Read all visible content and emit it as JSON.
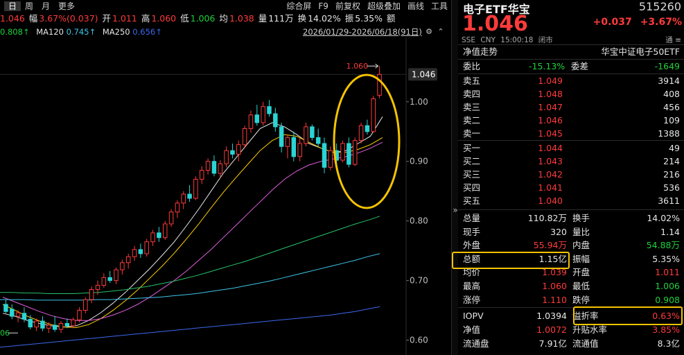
{
  "toolbar": {
    "periods": [
      "日",
      "周",
      "月",
      "更多"
    ],
    "tools": [
      "综合屏",
      "F9",
      "前复权",
      "超级叠加",
      "画线",
      "工具"
    ]
  },
  "quote_line": {
    "price": "1.046",
    "range_label": "幅",
    "range_value": "3.67%(0.037)",
    "open_label": "开",
    "open_value": "1.011",
    "high_label": "高",
    "high_value": "1.060",
    "low_label": "低",
    "low_value": "1.006",
    "avg_label": "均",
    "avg_value": "1.038",
    "vol_label": "量",
    "vol_value": "111万",
    "turn_label": "换",
    "turn_value": "14.02%",
    "amp_label": "振",
    "amp_value": "5.35%",
    "amt_label": "额"
  },
  "ma_line": {
    "ma60_value": "0.808",
    "ma120_label": "MA120",
    "ma120_value": "0.745",
    "ma250_label": "MA250",
    "ma250_value": "0.656"
  },
  "date_range": "2026/01/29-2026/06/18(91日)",
  "chart_data": {
    "type": "candlestick",
    "y_ticks": [
      "1.00",
      "0.90",
      "0.80",
      "0.70",
      "0.60"
    ],
    "ylim": [
      0.575,
      1.108
    ],
    "current_price_tag": "1.046",
    "high_annotation": "1.060",
    "low_annotation_partial": "06",
    "candles": [
      {
        "o": 0.66,
        "h": 0.668,
        "l": 0.645,
        "c": 0.648
      },
      {
        "o": 0.652,
        "h": 0.66,
        "l": 0.635,
        "c": 0.64
      },
      {
        "o": 0.64,
        "h": 0.65,
        "l": 0.63,
        "c": 0.646
      },
      {
        "o": 0.645,
        "h": 0.655,
        "l": 0.63,
        "c": 0.635
      },
      {
        "o": 0.635,
        "h": 0.642,
        "l": 0.618,
        "c": 0.622
      },
      {
        "o": 0.622,
        "h": 0.636,
        "l": 0.615,
        "c": 0.632
      },
      {
        "o": 0.632,
        "h": 0.64,
        "l": 0.615,
        "c": 0.62
      },
      {
        "o": 0.62,
        "h": 0.63,
        "l": 0.612,
        "c": 0.625
      },
      {
        "o": 0.625,
        "h": 0.64,
        "l": 0.614,
        "c": 0.618
      },
      {
        "o": 0.618,
        "h": 0.632,
        "l": 0.612,
        "c": 0.628
      },
      {
        "o": 0.628,
        "h": 0.636,
        "l": 0.62,
        "c": 0.624
      },
      {
        "o": 0.624,
        "h": 0.638,
        "l": 0.62,
        "c": 0.634
      },
      {
        "o": 0.634,
        "h": 0.655,
        "l": 0.63,
        "c": 0.65
      },
      {
        "o": 0.65,
        "h": 0.672,
        "l": 0.645,
        "c": 0.668
      },
      {
        "o": 0.668,
        "h": 0.69,
        "l": 0.662,
        "c": 0.685
      },
      {
        "o": 0.685,
        "h": 0.7,
        "l": 0.676,
        "c": 0.692
      },
      {
        "o": 0.692,
        "h": 0.712,
        "l": 0.688,
        "c": 0.705
      },
      {
        "o": 0.705,
        "h": 0.716,
        "l": 0.696,
        "c": 0.7
      },
      {
        "o": 0.7,
        "h": 0.722,
        "l": 0.694,
        "c": 0.718
      },
      {
        "o": 0.718,
        "h": 0.735,
        "l": 0.71,
        "c": 0.73
      },
      {
        "o": 0.73,
        "h": 0.745,
        "l": 0.72,
        "c": 0.74
      },
      {
        "o": 0.74,
        "h": 0.758,
        "l": 0.733,
        "c": 0.752
      },
      {
        "o": 0.752,
        "h": 0.762,
        "l": 0.738,
        "c": 0.745
      },
      {
        "o": 0.745,
        "h": 0.77,
        "l": 0.74,
        "c": 0.765
      },
      {
        "o": 0.765,
        "h": 0.785,
        "l": 0.758,
        "c": 0.78
      },
      {
        "o": 0.78,
        "h": 0.79,
        "l": 0.765,
        "c": 0.772
      },
      {
        "o": 0.772,
        "h": 0.8,
        "l": 0.768,
        "c": 0.795
      },
      {
        "o": 0.795,
        "h": 0.82,
        "l": 0.79,
        "c": 0.815
      },
      {
        "o": 0.815,
        "h": 0.835,
        "l": 0.805,
        "c": 0.83
      },
      {
        "o": 0.83,
        "h": 0.85,
        "l": 0.82,
        "c": 0.845
      },
      {
        "o": 0.845,
        "h": 0.86,
        "l": 0.832,
        "c": 0.838
      },
      {
        "o": 0.838,
        "h": 0.875,
        "l": 0.835,
        "c": 0.87
      },
      {
        "o": 0.87,
        "h": 0.892,
        "l": 0.862,
        "c": 0.885
      },
      {
        "o": 0.885,
        "h": 0.905,
        "l": 0.878,
        "c": 0.9
      },
      {
        "o": 0.9,
        "h": 0.91,
        "l": 0.875,
        "c": 0.88
      },
      {
        "o": 0.88,
        "h": 0.902,
        "l": 0.872,
        "c": 0.896
      },
      {
        "o": 0.896,
        "h": 0.925,
        "l": 0.89,
        "c": 0.918
      },
      {
        "o": 0.918,
        "h": 0.93,
        "l": 0.905,
        "c": 0.912
      },
      {
        "o": 0.912,
        "h": 0.935,
        "l": 0.9,
        "c": 0.928
      },
      {
        "o": 0.928,
        "h": 0.96,
        "l": 0.922,
        "c": 0.955
      },
      {
        "o": 0.955,
        "h": 0.985,
        "l": 0.948,
        "c": 0.978
      },
      {
        "o": 0.978,
        "h": 0.995,
        "l": 0.96,
        "c": 0.965
      },
      {
        "o": 0.965,
        "h": 1.0,
        "l": 0.96,
        "c": 0.992
      },
      {
        "o": 0.992,
        "h": 1.003,
        "l": 0.975,
        "c": 0.98
      },
      {
        "o": 0.98,
        "h": 0.99,
        "l": 0.95,
        "c": 0.958
      },
      {
        "o": 0.958,
        "h": 0.965,
        "l": 0.915,
        "c": 0.925
      },
      {
        "o": 0.925,
        "h": 0.945,
        "l": 0.905,
        "c": 0.94
      },
      {
        "o": 0.94,
        "h": 0.95,
        "l": 0.9,
        "c": 0.908
      },
      {
        "o": 0.908,
        "h": 0.94,
        "l": 0.9,
        "c": 0.93
      },
      {
        "o": 0.93,
        "h": 0.965,
        "l": 0.925,
        "c": 0.958
      },
      {
        "o": 0.958,
        "h": 0.962,
        "l": 0.935,
        "c": 0.94
      },
      {
        "o": 0.94,
        "h": 0.955,
        "l": 0.925,
        "c": 0.93
      },
      {
        "o": 0.93,
        "h": 0.94,
        "l": 0.88,
        "c": 0.89
      },
      {
        "o": 0.89,
        "h": 0.925,
        "l": 0.885,
        "c": 0.918
      },
      {
        "o": 0.918,
        "h": 0.93,
        "l": 0.895,
        "c": 0.902
      },
      {
        "o": 0.902,
        "h": 0.935,
        "l": 0.898,
        "c": 0.93
      },
      {
        "o": 0.93,
        "h": 0.94,
        "l": 0.89,
        "c": 0.895
      },
      {
        "o": 0.895,
        "h": 0.94,
        "l": 0.892,
        "c": 0.935
      },
      {
        "o": 0.935,
        "h": 0.965,
        "l": 0.93,
        "c": 0.96
      },
      {
        "o": 0.96,
        "h": 0.97,
        "l": 0.945,
        "c": 0.95
      },
      {
        "o": 0.95,
        "h": 1.01,
        "l": 0.948,
        "c": 1.005
      },
      {
        "o": 1.011,
        "h": 1.06,
        "l": 1.006,
        "c": 1.046
      }
    ],
    "ma_series": [
      {
        "name": "short",
        "color": "#e8e8e8",
        "values": [
          0.645,
          0.64,
          0.633,
          0.628,
          0.624,
          0.622,
          0.624,
          0.633,
          0.646,
          0.662,
          0.68,
          0.7,
          0.72,
          0.742,
          0.765,
          0.792,
          0.82,
          0.85,
          0.88,
          0.905,
          0.93,
          0.955,
          0.965,
          0.958,
          0.945,
          0.93,
          0.922,
          0.915,
          0.918,
          0.93,
          0.942,
          0.975
        ]
      },
      {
        "name": "mid",
        "color": "#ffd000",
        "values": [
          0.66,
          0.65,
          0.64,
          0.632,
          0.626,
          0.622,
          0.621,
          0.626,
          0.636,
          0.65,
          0.666,
          0.684,
          0.704,
          0.724,
          0.746,
          0.77,
          0.795,
          0.822,
          0.848,
          0.872,
          0.895,
          0.918,
          0.935,
          0.945,
          0.942,
          0.932,
          0.922,
          0.915,
          0.915,
          0.92,
          0.928,
          0.94
        ]
      },
      {
        "name": "long",
        "color": "#e060e0",
        "values": [
          0.672,
          0.664,
          0.656,
          0.648,
          0.641,
          0.636,
          0.633,
          0.633,
          0.636,
          0.642,
          0.65,
          0.66,
          0.672,
          0.686,
          0.7,
          0.716,
          0.734,
          0.752,
          0.772,
          0.792,
          0.812,
          0.832,
          0.852,
          0.87,
          0.884,
          0.894,
          0.9,
          0.904,
          0.908,
          0.914,
          0.922,
          0.932
        ]
      },
      {
        "name": "MA60",
        "color": "#26c26a",
        "values": [
          0.68,
          0.68,
          0.679,
          0.679,
          0.678,
          0.678,
          0.678,
          0.679,
          0.68,
          0.682,
          0.684,
          0.687,
          0.69,
          0.694,
          0.698,
          0.703,
          0.708,
          0.714,
          0.72,
          0.726,
          0.732,
          0.739,
          0.746,
          0.753,
          0.76,
          0.767,
          0.774,
          0.781,
          0.788,
          0.795,
          0.801,
          0.808
        ]
      },
      {
        "name": "MA120",
        "color": "#3ec6ea",
        "values": [
          0.668,
          0.668,
          0.668,
          0.667,
          0.667,
          0.667,
          0.667,
          0.667,
          0.668,
          0.668,
          0.669,
          0.67,
          0.671,
          0.672,
          0.674,
          0.676,
          0.678,
          0.681,
          0.684,
          0.687,
          0.691,
          0.695,
          0.699,
          0.704,
          0.709,
          0.714,
          0.719,
          0.724,
          0.729,
          0.734,
          0.74,
          0.745
        ]
      },
      {
        "name": "MA250",
        "color": "#3b68f0",
        "values": [
          0.588,
          0.59,
          0.592,
          0.594,
          0.596,
          0.598,
          0.6,
          0.602,
          0.604,
          0.606,
          0.608,
          0.61,
          0.612,
          0.614,
          0.616,
          0.618,
          0.62,
          0.622,
          0.624,
          0.626,
          0.628,
          0.63,
          0.632,
          0.634,
          0.636,
          0.638,
          0.64,
          0.642,
          0.645,
          0.648,
          0.652,
          0.656
        ]
      }
    ]
  },
  "panel": {
    "name": "电子ETF华宝",
    "code": "515260",
    "price": "1.046",
    "change": "+0.037",
    "change_pct": "+3.67%",
    "market": "SSE",
    "currency": "CNY",
    "time": "15:00:18",
    "status": "闭市",
    "flag1": "通",
    "flag2": "≡",
    "nav_label": "净值走势",
    "index_name": "华宝中证电子50ETF",
    "weibi_label": "委比",
    "weibi_value": "-15.13%",
    "weicha_label": "委差",
    "weicha_value": "-1649",
    "asks": [
      {
        "label": "卖五",
        "price": "1.049",
        "vol": "3914"
      },
      {
        "label": "卖四",
        "price": "1.048",
        "vol": "408"
      },
      {
        "label": "卖三",
        "price": "1.047",
        "vol": "456"
      },
      {
        "label": "卖二",
        "price": "1.046",
        "vol": "109"
      },
      {
        "label": "卖一",
        "price": "1.045",
        "vol": "1388"
      }
    ],
    "bids": [
      {
        "label": "买一",
        "price": "1.044",
        "vol": "49"
      },
      {
        "label": "买二",
        "price": "1.043",
        "vol": "214"
      },
      {
        "label": "买三",
        "price": "1.042",
        "vol": "216"
      },
      {
        "label": "买四",
        "price": "1.041",
        "vol": "536"
      },
      {
        "label": "买五",
        "price": "1.040",
        "vol": "3611"
      }
    ],
    "stats": [
      {
        "l1": "总量",
        "v1": "110.82万",
        "c1": "white",
        "l2": "换手",
        "v2": "14.02%",
        "c2": "white"
      },
      {
        "l1": "现手",
        "v1": "320",
        "c1": "white",
        "l2": "量比",
        "v2": "1.14",
        "c2": "white"
      },
      {
        "l1": "外盘",
        "v1": "55.94万",
        "c1": "red",
        "l2": "内盘",
        "v2": "54.88万",
        "c2": "green"
      },
      {
        "l1": "总额",
        "v1": "1.15亿",
        "c1": "white",
        "l2": "振幅",
        "v2": "5.35%",
        "c2": "white"
      },
      {
        "l1": "均价",
        "v1": "1.039",
        "c1": "red",
        "l2": "开盘",
        "v2": "1.011",
        "c2": "red"
      },
      {
        "l1": "最高",
        "v1": "1.060",
        "c1": "red",
        "l2": "最低",
        "v2": "1.006",
        "c2": "green"
      },
      {
        "l1": "涨停",
        "v1": "1.110",
        "c1": "red",
        "l2": "跌停",
        "v2": "0.908",
        "c2": "green"
      }
    ],
    "stats2": [
      {
        "l1": "IOPV",
        "v1": "1.0394",
        "c1": "white",
        "l2": "溢折率",
        "v2": "0.63%",
        "c2": "red"
      },
      {
        "l1": "净值",
        "v1": "1.0072",
        "c1": "red",
        "l2": "升贴水率",
        "v2": "3.85%",
        "c2": "red"
      },
      {
        "l1": "流通盘",
        "v1": "7.91亿",
        "c1": "white",
        "l2": "流通值",
        "v2": "8.3亿",
        "c2": "white"
      }
    ]
  }
}
